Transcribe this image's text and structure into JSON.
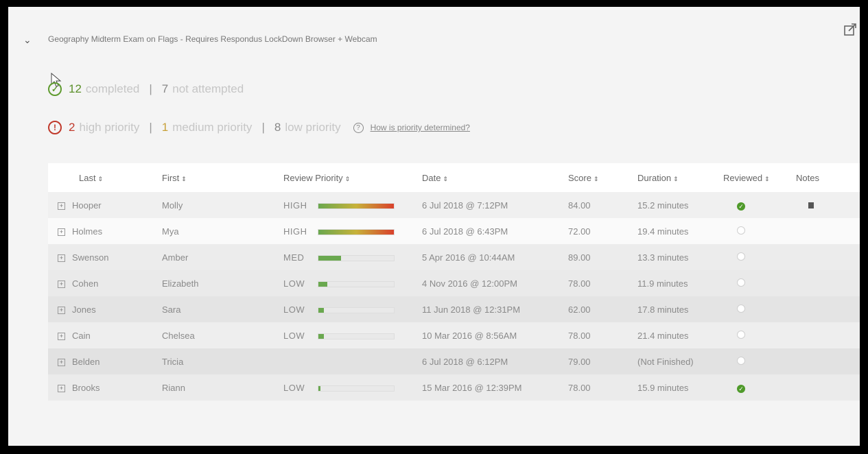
{
  "exam": {
    "title": "Geography Midterm Exam on Flags - Requires Respondus LockDown Browser + Webcam"
  },
  "stats": {
    "completed_count": "12",
    "completed_label": "completed",
    "not_attempted_count": "7",
    "not_attempted_label": "not attempted",
    "separator": "|",
    "high_count": "2",
    "high_label": "high priority",
    "medium_count": "1",
    "medium_label": "medium priority",
    "low_count": "8",
    "low_label": "low priority",
    "help_link": "How is priority determined?"
  },
  "table": {
    "columns": [
      "Last",
      "First",
      "Review Priority",
      "Date",
      "Score",
      "Duration",
      "Reviewed",
      "Notes"
    ],
    "sort_glyph": "⇕",
    "rows": [
      {
        "last": "Hooper",
        "first": "Molly",
        "priority": "HIGH",
        "priority_level": 1.0,
        "date": "6 Jul 2018 @ 7:12PM",
        "score": "84.00",
        "duration": "15.2 minutes",
        "reviewed": true,
        "notes": true
      },
      {
        "last": "Holmes",
        "first": "Mya",
        "priority": "HIGH",
        "priority_level": 1.0,
        "date": "6 Jul 2018 @ 6:43PM",
        "score": "72.00",
        "duration": "19.4 minutes",
        "reviewed": false,
        "notes": false
      },
      {
        "last": "Swenson",
        "first": "Amber",
        "priority": "MED",
        "priority_level": 0.3,
        "date": "5 Apr 2016 @ 10:44AM",
        "score": "89.00",
        "duration": "13.3 minutes",
        "reviewed": false,
        "notes": false
      },
      {
        "last": "Cohen",
        "first": "Elizabeth",
        "priority": "LOW",
        "priority_level": 0.12,
        "date": "4 Nov 2016 @ 12:00PM",
        "score": "78.00",
        "duration": "11.9 minutes",
        "reviewed": false,
        "notes": false
      },
      {
        "last": "Jones",
        "first": "Sara",
        "priority": "LOW",
        "priority_level": 0.07,
        "date": "11 Jun 2018 @ 12:31PM",
        "score": "62.00",
        "duration": "17.8 minutes",
        "reviewed": false,
        "notes": false
      },
      {
        "last": "Cain",
        "first": "Chelsea",
        "priority": "LOW",
        "priority_level": 0.07,
        "date": "10 Mar 2016 @ 8:56AM",
        "score": "78.00",
        "duration": "21.4 minutes",
        "reviewed": false,
        "notes": false
      },
      {
        "last": "Belden",
        "first": "Tricia",
        "priority": "",
        "priority_level": 0,
        "date": "6 Jul 2018 @ 6:12PM",
        "score": "79.00",
        "duration": "(Not Finished)",
        "reviewed": false,
        "notes": false
      },
      {
        "last": "Brooks",
        "first": "Riann",
        "priority": "LOW",
        "priority_level": 0.03,
        "date": "15 Mar 2016 @ 12:39PM",
        "score": "78.00",
        "duration": "15.9 minutes",
        "reviewed": true,
        "notes": false
      }
    ]
  },
  "colors": {
    "completed": "#5b8f2a",
    "high": "#c0392b",
    "medium": "#c8a038",
    "bar_green": "#6aa84f",
    "bar_red": "#d9412c"
  }
}
